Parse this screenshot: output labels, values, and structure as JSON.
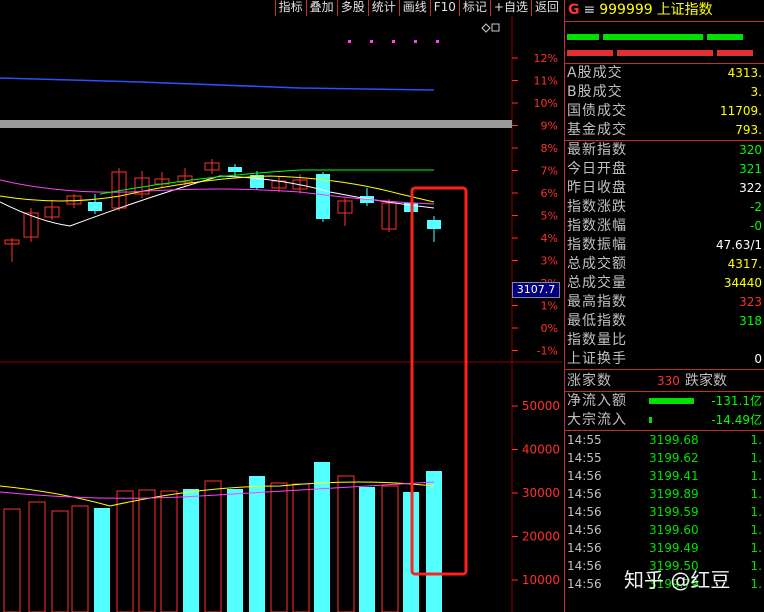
{
  "toolbar": [
    "指标",
    "叠加",
    "多股",
    "统计",
    "画线",
    "F10",
    "标记",
    "+自选",
    "返回"
  ],
  "chart": {
    "pct_labels": [
      "12%",
      "11%",
      "10%",
      "9%",
      "8%",
      "7%",
      "6%",
      "5%",
      "4%",
      "3%",
      "2%",
      "1%",
      "0%",
      "-1%"
    ],
    "vol_labels": [
      "50000",
      "40000",
      "30000",
      "20000",
      "10000"
    ],
    "current_price": "3107.7",
    "colors": {
      "up": "#ff3030",
      "down": "#54ffff",
      "ma_white": "#ffffff",
      "ma_yellow": "#ffff00",
      "ma_magenta": "#ff40ff",
      "ma_green": "#00ff00",
      "grid": "#8b0000",
      "highlight": "#ff2020"
    }
  },
  "panel": {
    "g_mark": "G",
    "eq_mark": "≡",
    "code": "999999",
    "name": "上证指数",
    "stats": [
      {
        "label": "A股成交",
        "value": "4313.",
        "color": "#ffff00"
      },
      {
        "label": "B股成交",
        "value": "3.",
        "color": "#ffff00"
      },
      {
        "label": "国债成交",
        "value": "11709.",
        "color": "#ffff00"
      },
      {
        "label": "基金成交",
        "value": "793.",
        "color": "#ffff00"
      }
    ],
    "index": [
      {
        "label": "最新指数",
        "value": "320",
        "color": "#00ff00"
      },
      {
        "label": "今日开盘",
        "value": "321",
        "color": "#00ff00"
      },
      {
        "label": "昨日收盘",
        "value": "322",
        "color": "#ffffff"
      },
      {
        "label": "指数涨跌",
        "value": "-2",
        "color": "#00ff00"
      },
      {
        "label": "指数涨幅",
        "value": "-0",
        "color": "#00ff00"
      },
      {
        "label": "指数振幅",
        "value": "47.63/1",
        "color": "#ffffff"
      },
      {
        "label": "总成交额",
        "value": "4317.",
        "color": "#ffff00"
      },
      {
        "label": "总成交量",
        "value": "34440",
        "color": "#ffff00"
      },
      {
        "label": "最高指数",
        "value": "323",
        "color": "#ff3030"
      },
      {
        "label": "最低指数",
        "value": "318",
        "color": "#00ff00"
      },
      {
        "label": "指数量比",
        "value": "",
        "color": "#ffffff"
      },
      {
        "label": "上证换手",
        "value": "0",
        "color": "#ffffff"
      }
    ],
    "breadth": {
      "up_label": "涨家数",
      "up_count": "330",
      "down_label": "跌家数"
    },
    "flows": [
      {
        "label": "净流入额",
        "value": "-131.1亿",
        "bar": 0.75
      },
      {
        "label": "大宗流入",
        "value": "-14.49亿",
        "bar": 0.05
      }
    ],
    "ticks": [
      {
        "t": "14:55",
        "p": "3199.68",
        "v": "1."
      },
      {
        "t": "14:55",
        "p": "3199.62",
        "v": "1."
      },
      {
        "t": "14:56",
        "p": "3199.41",
        "v": "1."
      },
      {
        "t": "14:56",
        "p": "3199.89",
        "v": "1."
      },
      {
        "t": "14:56",
        "p": "3199.59",
        "v": "1."
      },
      {
        "t": "14:56",
        "p": "3199.60",
        "v": "1."
      },
      {
        "t": "14:56",
        "p": "3199.49",
        "v": "1."
      },
      {
        "t": "14:56",
        "p": "3199.50",
        "v": "1."
      },
      {
        "t": "14:56",
        "p": "3199.79",
        "v": "1."
      }
    ]
  },
  "watermark": "知乎 @红豆"
}
